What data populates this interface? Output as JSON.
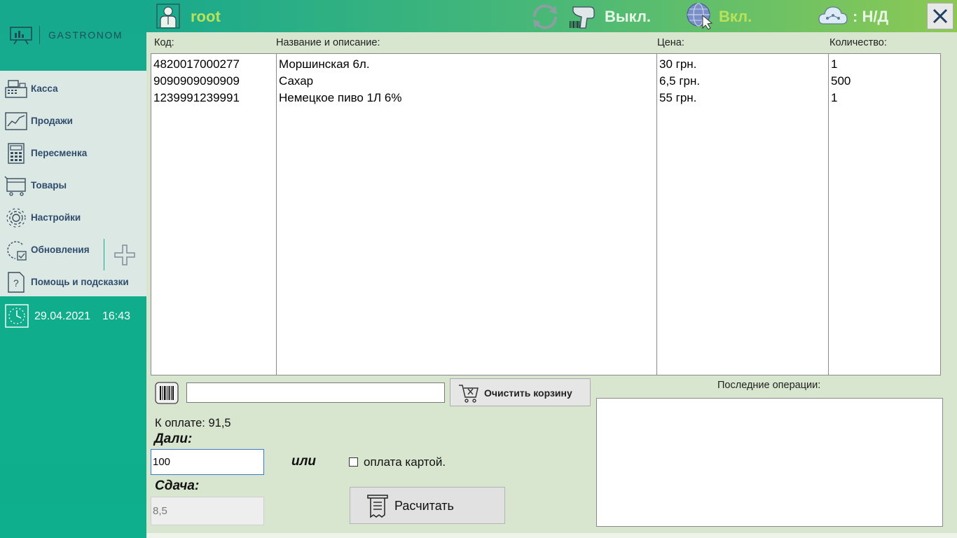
{
  "logo": {
    "text": "GASTRONOM"
  },
  "menu": {
    "items": [
      {
        "label": "Касса",
        "icon": "cash-register-icon"
      },
      {
        "label": "Продажи",
        "icon": "sales-chart-icon"
      },
      {
        "label": "Пересменка",
        "icon": "calculator-icon"
      },
      {
        "label": "Товары",
        "icon": "goods-cart-icon"
      },
      {
        "label": "Настройки",
        "icon": "settings-gear-icon"
      },
      {
        "label": "Обновления",
        "icon": "updates-icon"
      },
      {
        "label": "Помощь и подсказки",
        "icon": "help-icon"
      }
    ]
  },
  "clock": {
    "date": "29.04.2021",
    "time": "16:43"
  },
  "topbar": {
    "user": "root",
    "scanner_status": "Выкл.",
    "network_status": "Вкл.",
    "cloud_status": ": Н/Д"
  },
  "table": {
    "headers": {
      "code": "Код:",
      "name": "Название и описание:",
      "price": "Цена:",
      "qty": "Количество:"
    },
    "rows": [
      {
        "code": "4820017000277",
        "name": "Моршинская 6л.",
        "price": "30 грн.",
        "qty": "1"
      },
      {
        "code": "9090909090909",
        "name": "Сахар",
        "price": "6,5 грн.",
        "qty": "500"
      },
      {
        "code": "1239991239991",
        "name": "Немецкое пиво 1Л 6%",
        "price": "55 грн.",
        "qty": "1"
      }
    ]
  },
  "cart": {
    "code_input_value": "",
    "clear_label": "Очистить корзину"
  },
  "payment": {
    "to_pay_label": "К оплате: 91,5",
    "given_label": "Дали:",
    "given_value": "100",
    "or_label": "или",
    "card_label": "оплата картой.",
    "card_checked": false,
    "change_label": "Сдача:",
    "change_value": "8,5",
    "pay_button": "Расчитать"
  },
  "recent": {
    "title": "Последние операции:"
  },
  "colors": {
    "accent": "#17a98e",
    "lime": "#b7e25a",
    "menu_text": "#2f4c6d"
  }
}
